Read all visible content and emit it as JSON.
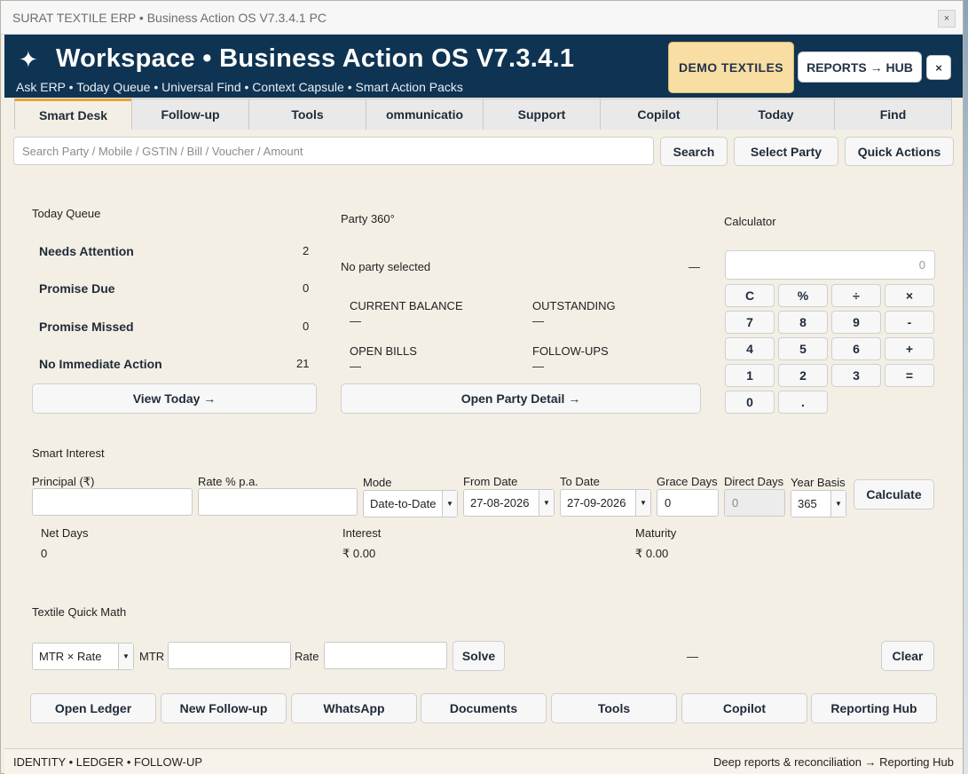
{
  "window": {
    "title": "SURAT TEXTILE ERP • Business Action OS V7.3.4.1 PC",
    "close_glyph": "×"
  },
  "header": {
    "star": "✦",
    "title": "Workspace • Business Action OS V7.3.4.1",
    "subtitle": "Ask ERP • Today Queue • Universal Find • Context Capsule • Smart Action Packs",
    "company_badge": "DEMO TEXTILES",
    "reports_button": "REPORTS → HUB",
    "close_button": "×"
  },
  "tabs": [
    {
      "label": "Smart Desk",
      "active": true
    },
    {
      "label": "Follow-up"
    },
    {
      "label": "Tools"
    },
    {
      "label": "ommunicatio"
    },
    {
      "label": "Support"
    },
    {
      "label": "Copilot"
    },
    {
      "label": "Today"
    },
    {
      "label": "Find"
    }
  ],
  "search": {
    "placeholder": "Search Party / Mobile / GSTIN / Bill / Voucher / Amount",
    "search_button": "Search",
    "select_party_button": "Select Party",
    "quick_actions_button": "Quick Actions"
  },
  "today_queue": {
    "title": "Today Queue",
    "items": [
      {
        "label": "Needs Attention",
        "count": "2"
      },
      {
        "label": "Promise Due",
        "count": "0"
      },
      {
        "label": "Promise Missed",
        "count": "0"
      },
      {
        "label": "No Immediate Action",
        "count": "21"
      }
    ],
    "view_button": "View Today →"
  },
  "party360": {
    "title": "Party 360°",
    "status": "No party selected",
    "status_value": "—",
    "current_balance_label": "CURRENT BALANCE",
    "current_balance_value": "—",
    "outstanding_label": "OUTSTANDING",
    "outstanding_value": "—",
    "open_bills_label": "OPEN BILLS",
    "open_bills_value": "—",
    "followups_label": "FOLLOW-UPS",
    "followups_value": "—",
    "detail_button": "Open Party Detail →"
  },
  "calculator": {
    "title": "Calculator",
    "display": "0",
    "keys": [
      "C",
      "%",
      "÷",
      "×",
      "7",
      "8",
      "9",
      "-",
      "4",
      "5",
      "6",
      "+",
      "1",
      "2",
      "3",
      "=",
      "0",
      "."
    ]
  },
  "smart_interest": {
    "title": "Smart Interest",
    "principal_label": "Principal (₹)",
    "principal_value": "",
    "rate_label": "Rate % p.a.",
    "rate_value": "",
    "mode_label": "Mode",
    "mode_value": "Date-to-Date",
    "from_date_label": "From Date",
    "from_date_value": "27-08-2026",
    "to_date_label": "To Date",
    "to_date_value": "27-09-2026",
    "grace_days_label": "Grace Days",
    "grace_days_value": "0",
    "direct_days_label": "Direct Days",
    "direct_days_value": "0",
    "year_basis_label": "Year Basis",
    "year_basis_value": "365",
    "calculate_button": "Calculate",
    "net_days_label": "Net Days",
    "net_days_value": "0",
    "interest_label": "Interest",
    "interest_value": "₹ 0.00",
    "maturity_label": "Maturity",
    "maturity_value": "₹ 0.00"
  },
  "textile_math": {
    "title": "Textile Quick Math",
    "mode_value": "MTR × Rate",
    "mtr_label": "MTR",
    "mtr_value": "",
    "rate_label": "Rate",
    "rate_value": "",
    "solve_button": "Solve",
    "result": "—",
    "clear_button": "Clear"
  },
  "action_bar": [
    "Open Ledger",
    "New Follow-up",
    "WhatsApp",
    "Documents",
    "Tools",
    "Copilot",
    "Reporting Hub"
  ],
  "statusbar": {
    "left": "IDENTITY • LEDGER • FOLLOW-UP",
    "right": "Deep reports & reconciliation → Reporting Hub"
  }
}
